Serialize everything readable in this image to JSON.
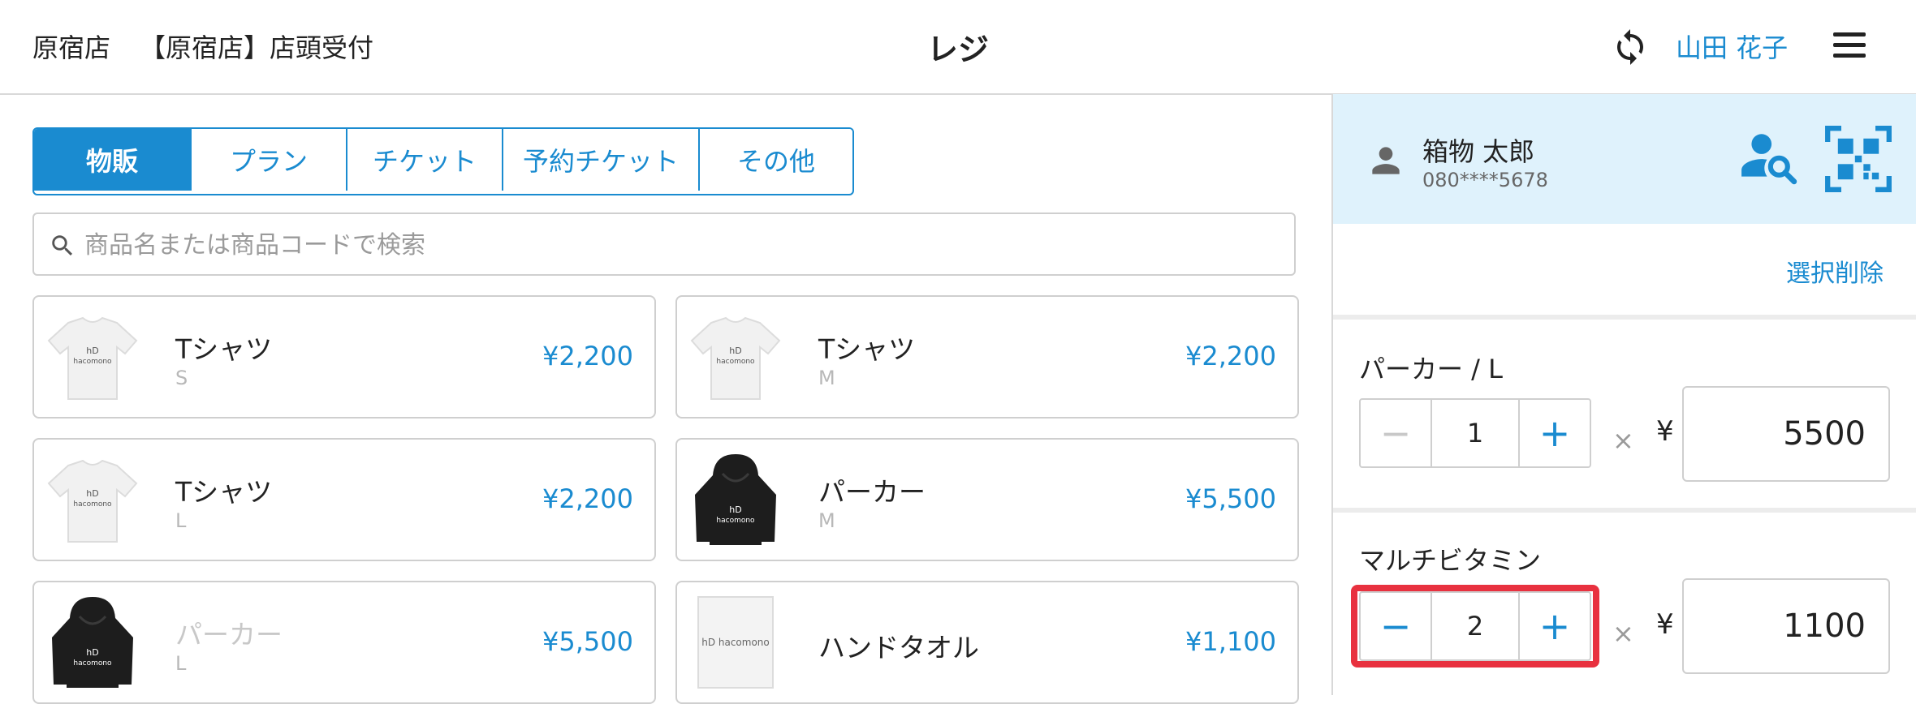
{
  "header": {
    "store": "原宿店",
    "terminal": "【原宿店】店頭受付",
    "title": "レジ",
    "user": "山田 花子"
  },
  "tabs": [
    {
      "label": "物販",
      "active": true
    },
    {
      "label": "プラン",
      "active": false
    },
    {
      "label": "チケット",
      "active": false
    },
    {
      "label": "予約チケット",
      "active": false
    },
    {
      "label": "その他",
      "active": false
    }
  ],
  "search": {
    "placeholder": "商品名または商品コードで検索"
  },
  "products": [
    {
      "name": "Tシャツ",
      "variant": "S",
      "price": "¥2,200",
      "image": "white-tshirt"
    },
    {
      "name": "Tシャツ",
      "variant": "M",
      "price": "¥2,200",
      "image": "white-tshirt"
    },
    {
      "name": "Tシャツ",
      "variant": "L",
      "price": "¥2,200",
      "image": "white-tshirt"
    },
    {
      "name": "パーカー",
      "variant": "M",
      "price": "¥5,500",
      "image": "black-hoodie"
    },
    {
      "name": "パーカー",
      "variant": "L",
      "price": "¥5,500",
      "image": "black-hoodie"
    },
    {
      "name": "ハンドタオル",
      "variant": "",
      "price": "¥1,100",
      "image": "hand-towel"
    }
  ],
  "brand": "hacomono",
  "customer": {
    "name": "箱物 太郎",
    "phone": "080****5678"
  },
  "cart": {
    "clear_label": "選択削除",
    "times": "×",
    "yen": "¥",
    "items": [
      {
        "name": "パーカー / L",
        "qty": "1",
        "price": "5500"
      },
      {
        "name": "マルチビタミン",
        "qty": "2",
        "price": "1100"
      }
    ]
  },
  "colors": {
    "accent": "#1a8bd0",
    "highlight": "#e8313f",
    "customer_bg": "#dff2fc"
  }
}
